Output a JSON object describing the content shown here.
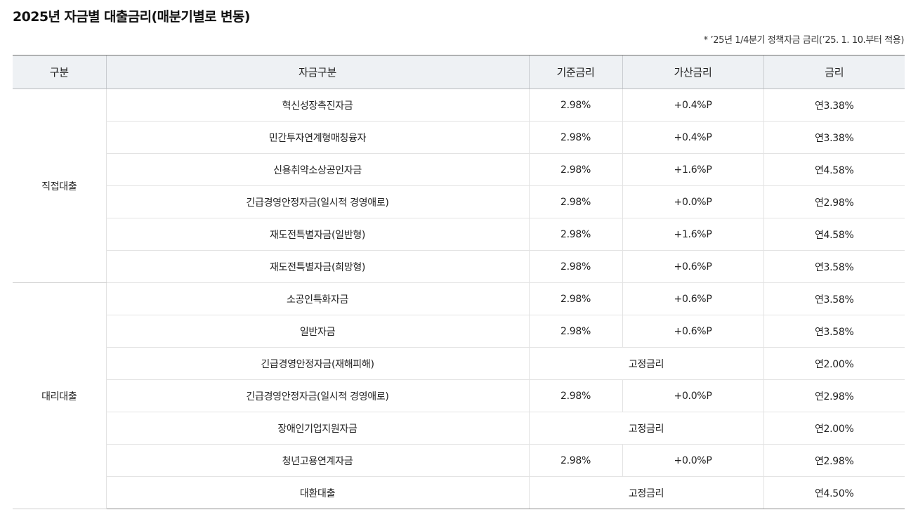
{
  "title": "2025년 자금별 대출금리(매분기별로 변동)",
  "notice": "* ’25년 1/4분기 정책자금 금리(’25. 1. 10.부터 적용)",
  "columns": [
    "구분",
    "자금구분",
    "기준금리",
    "가산금리",
    "금리"
  ],
  "groups": [
    {
      "label": "직접대출",
      "rows": [
        {
          "fund": "혁신성장촉진자금",
          "base": "2.98%",
          "spread": "+0.4%P",
          "rate": "연3.38%"
        },
        {
          "fund": "민간투자연계형매칭융자",
          "base": "2.98%",
          "spread": "+0.4%P",
          "rate": "연3.38%"
        },
        {
          "fund": "신용취약소상공인자금",
          "base": "2.98%",
          "spread": "+1.6%P",
          "rate": "연4.58%"
        },
        {
          "fund": "긴급경영안정자금(일시적 경영애로)",
          "base": "2.98%",
          "spread": "+0.0%P",
          "rate": "연2.98%"
        },
        {
          "fund": "재도전특별자금(일반형)",
          "base": "2.98%",
          "spread": "+1.6%P",
          "rate": "연4.58%"
        },
        {
          "fund": "재도전특별자금(희망형)",
          "base": "2.98%",
          "spread": "+0.6%P",
          "rate": "연3.58%"
        }
      ]
    },
    {
      "label": "대리대출",
      "rows": [
        {
          "fund": "소공인특화자금",
          "base": "2.98%",
          "spread": "+0.6%P",
          "rate": "연3.58%"
        },
        {
          "fund": "일반자금",
          "base": "2.98%",
          "spread": "+0.6%P",
          "rate": "연3.58%"
        },
        {
          "fund": "긴급경영안정자금(재해피해)",
          "fixed": "고정금리",
          "rate": "연2.00%"
        },
        {
          "fund": "긴급경영안정자금(일시적 경영애로)",
          "base": "2.98%",
          "spread": "+0.0%P",
          "rate": "연2.98%"
        },
        {
          "fund": "장애인기업지원자금",
          "fixed": "고정금리",
          "rate": "연2.00%"
        },
        {
          "fund": "청년고용연계자금",
          "base": "2.98%",
          "spread": "+0.0%P",
          "rate": "연2.98%"
        },
        {
          "fund": "대환대출",
          "fixed": "고정금리",
          "rate": "연4.50%"
        }
      ]
    }
  ]
}
